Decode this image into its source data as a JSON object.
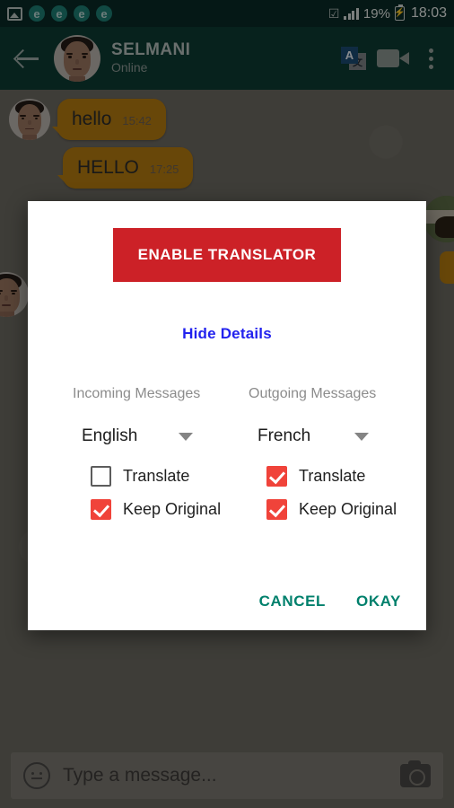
{
  "status_bar": {
    "left_icons": [
      "image-icon",
      "e-badge",
      "e-badge",
      "e-badge",
      "e-badge"
    ],
    "badge_letter": "e",
    "wifi": "wifi-icon",
    "signal": "signal-icon",
    "battery_percent": "19%",
    "battery_state": "charging",
    "clock": "18:03",
    "bg_color": "#0a2a26"
  },
  "app_bar": {
    "back_icon": "back-arrow-icon",
    "contact_name": "SELMANI",
    "contact_status": "Online",
    "translate_icon_letters": {
      "primary": "A",
      "secondary": "文"
    },
    "video_icon": "video-camera-icon",
    "overflow_icon": "more-vertical-icon",
    "bg_color": "#0d3b33"
  },
  "chat": {
    "messages": [
      {
        "text": "hello",
        "time": "15:42",
        "direction": "incoming",
        "bubble_color": "#b37a10"
      },
      {
        "text": "HELLO",
        "time": "17:25",
        "direction": "incoming",
        "bubble_color": "#b37a10"
      }
    ]
  },
  "input_bar": {
    "emoji_icon": "emoji-icon",
    "placeholder": "Type a message...",
    "value": "",
    "camera_icon": "camera-icon"
  },
  "dialog": {
    "enable_button": "ENABLE TRANSLATOR",
    "enable_button_color": "#cc2127",
    "details_link": "Hide Details",
    "details_link_color": "#2222ee",
    "columns": [
      {
        "header": "Incoming Messages",
        "language": "English",
        "options": [
          {
            "label": "Translate",
            "checked": false
          },
          {
            "label": "Keep Original",
            "checked": true
          }
        ]
      },
      {
        "header": "Outgoing Messages",
        "language": "French",
        "options": [
          {
            "label": "Translate",
            "checked": true
          },
          {
            "label": "Keep Original",
            "checked": true
          }
        ]
      }
    ],
    "checkbox_color": "#f0433a",
    "cancel_label": "CANCEL",
    "okay_label": "OKAY",
    "action_color": "#00806c"
  }
}
